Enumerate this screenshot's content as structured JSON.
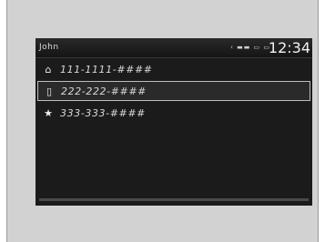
{
  "status_bar": {
    "contact_name": "John",
    "status_indicators": "‹ ▬▬ ▭ ▭",
    "clock": "12:34"
  },
  "phone_list": {
    "items": [
      {
        "icon": "home-icon",
        "glyph": "⌂",
        "number": "111-1111-####"
      },
      {
        "icon": "mobile-icon",
        "glyph": "▯",
        "number": "222-222-####",
        "selected": true
      },
      {
        "icon": "star-icon",
        "glyph": "★",
        "number": "333-333-####"
      }
    ]
  },
  "colors": {
    "screen_background": "#1b1b1b",
    "text": "#d8d8d8",
    "selection_border": "#bdbdbd",
    "frame_background": "#d2d2d2"
  }
}
